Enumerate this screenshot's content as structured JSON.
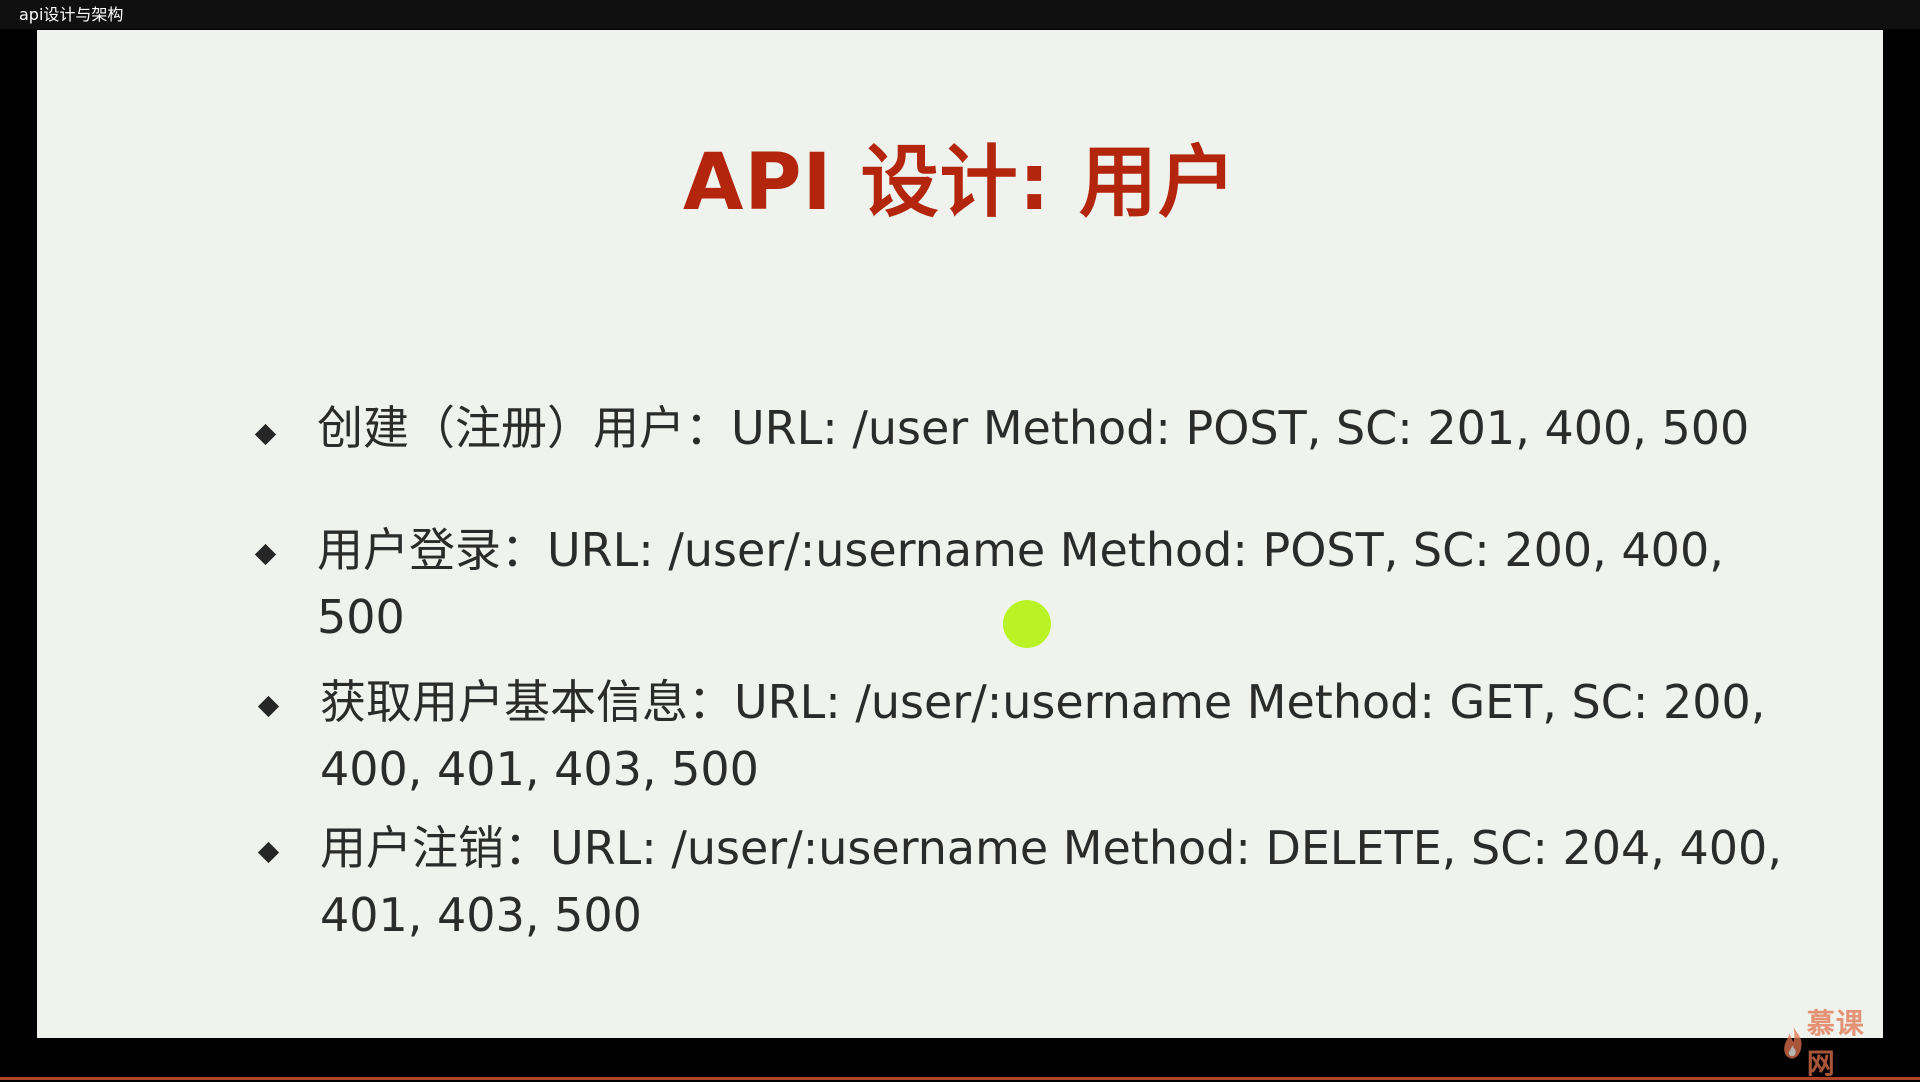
{
  "window": {
    "title": "api设计与架构"
  },
  "slide": {
    "title": "API 设计: 用户",
    "bullets": [
      {
        "lines": [
          "创建（注册）用户：URL: /user  Method: POST, SC: 201, 400, 500"
        ]
      },
      {
        "lines": [
          "用户登录：URL: /user/:username  Method: POST, SC: 200, 400,",
          "500"
        ]
      },
      {
        "lines": [
          "获取用户基本信息：URL: /user/:username Method: GET, SC: 200,",
          "400, 401, 403, 500"
        ]
      },
      {
        "lines": [
          "用户注销：URL: /user/:username Method: DELETE, SC: 204, 400,",
          "401, 403, 500"
        ]
      }
    ]
  },
  "watermark": {
    "text": "慕课网",
    "icon": "flame-logo-icon"
  },
  "colors": {
    "title": "#b3260d",
    "slide_background": "#eff2ed",
    "pointer": "#b5f21b",
    "watermark": "#e0724c"
  }
}
